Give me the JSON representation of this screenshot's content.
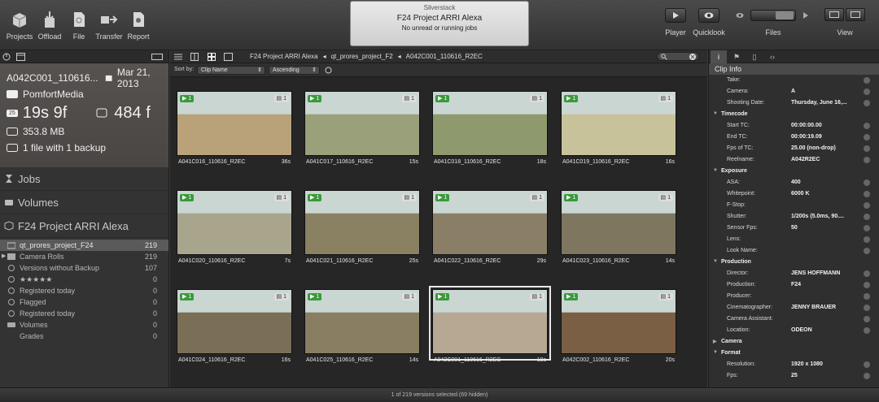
{
  "toolbar": {
    "buttons": [
      {
        "label": "Projects",
        "icon": "projects-icon"
      },
      {
        "label": "Offload",
        "icon": "offload-icon"
      },
      {
        "label": "File",
        "icon": "file-icon"
      },
      {
        "label": "Transfer",
        "icon": "transfer-icon"
      },
      {
        "label": "Report",
        "icon": "report-icon"
      }
    ],
    "status": {
      "app": "Silverstack",
      "project": "F24 Project ARRI Alexa",
      "jobs": "No unread or running jobs"
    },
    "right": [
      {
        "label": "Player"
      },
      {
        "label": "Quicklook"
      },
      {
        "label": "Files"
      },
      {
        "label": "View"
      }
    ]
  },
  "left": {
    "clip_name": "A042C001_110616...",
    "date": "Mar 21, 2013",
    "owner": "PomfortMedia",
    "fps_chip": "25",
    "duration": "19s 9f",
    "frames": "484 f",
    "size": "353.8 MB",
    "backup": "1 file with 1 backup",
    "sections": [
      "Jobs",
      "Volumes",
      "F24 Project ARRI Alexa"
    ],
    "items": [
      {
        "label": "qt_prores_project_F24",
        "count": "219"
      },
      {
        "label": "Camera Rolls",
        "count": "219"
      },
      {
        "label": "Versions without Backup",
        "count": "107"
      },
      {
        "label": "★★★★★",
        "count": "0"
      },
      {
        "label": "Registered today",
        "count": "0"
      },
      {
        "label": "Flagged",
        "count": "0"
      },
      {
        "label": "Registered today",
        "count": "0"
      },
      {
        "label": "Volumes",
        "count": "0"
      },
      {
        "label": "Grades",
        "count": "0"
      }
    ]
  },
  "center": {
    "breadcrumb": [
      "F24 Project ARRI Alexa",
      "qt_prores_project_F2",
      "A042C001_110616_R2EC"
    ],
    "sort_by_label": "Sort by:",
    "sort_field": "Clip Name",
    "sort_order": "Ascending",
    "clips": [
      {
        "name": "A041C016_110616_R2EC",
        "dur": "36s",
        "badge": "1",
        "bg": "#b9a27a"
      },
      {
        "name": "A041C017_110616_R2EC",
        "dur": "15s",
        "badge": "1",
        "bg": "#9aa07a"
      },
      {
        "name": "A041C018_110616_R2EC",
        "dur": "18s",
        "badge": "1",
        "bg": "#8e9a6e"
      },
      {
        "name": "A041C019_110616_R2EC",
        "dur": "16s",
        "badge": "1",
        "bg": "#c8c29a"
      },
      {
        "name": "A041C020_110616_R2EC",
        "dur": "7s",
        "badge": "1",
        "bg": "#a9a48c"
      },
      {
        "name": "A041C021_110616_R2EC",
        "dur": "25s",
        "badge": "1",
        "bg": "#8a8062"
      },
      {
        "name": "A041C022_110616_R2EC",
        "dur": "29s",
        "badge": "1",
        "bg": "#8a7f66"
      },
      {
        "name": "A041C023_110616_R2EC",
        "dur": "14s",
        "badge": "1",
        "bg": "#7f7660"
      },
      {
        "name": "A041C024_110616_R2EC",
        "dur": "16s",
        "badge": "1",
        "bg": "#7a6e56"
      },
      {
        "name": "A041C025_110616_R2EC",
        "dur": "14s",
        "badge": "1",
        "bg": "#8a7e62"
      },
      {
        "name": "A042C001_110616_R2EC",
        "dur": "19s",
        "badge": "1",
        "bg": "#b7a894"
      },
      {
        "name": "A042C002_110616_R2EC",
        "dur": "20s",
        "badge": "1",
        "bg": "#7a5f44"
      }
    ],
    "status": "1 of 219 versions selected (69 hidden)"
  },
  "right": {
    "header": "Clip Info",
    "rows": [
      {
        "type": "kv",
        "k": "Take:",
        "v": ""
      },
      {
        "type": "kv",
        "k": "Camera:",
        "v": "A"
      },
      {
        "type": "kv",
        "k": "Shooting Date:",
        "v": "Thursday, June 16,..."
      },
      {
        "type": "grp",
        "t": "Timecode"
      },
      {
        "type": "kv",
        "k": "Start TC:",
        "v": "00:00:00.00"
      },
      {
        "type": "kv",
        "k": "End TC:",
        "v": "00:00:19.09"
      },
      {
        "type": "kv",
        "k": "Fps of TC:",
        "v": "25.00 (non-drop)"
      },
      {
        "type": "kv",
        "k": "Reelname:",
        "v": "A042R2EC"
      },
      {
        "type": "grp",
        "t": "Exposure"
      },
      {
        "type": "kv",
        "k": "ASA:",
        "v": "400"
      },
      {
        "type": "kv",
        "k": "Whitepoint:",
        "v": "6000 K"
      },
      {
        "type": "kv",
        "k": "F-Stop:",
        "v": ""
      },
      {
        "type": "kv",
        "k": "Shutter:",
        "v": "1/200s (5.0ms, 90...."
      },
      {
        "type": "kv",
        "k": "Sensor Fps:",
        "v": "50"
      },
      {
        "type": "kv",
        "k": "Lens:",
        "v": ""
      },
      {
        "type": "kv",
        "k": "Look Name:",
        "v": ""
      },
      {
        "type": "grp",
        "t": "Production"
      },
      {
        "type": "kv",
        "k": "Director:",
        "v": "JENS HOFFMANN"
      },
      {
        "type": "kv",
        "k": "Production:",
        "v": "F24"
      },
      {
        "type": "kv",
        "k": "Producer:",
        "v": ""
      },
      {
        "type": "kv",
        "k": "Cinematographer:",
        "v": "JENNY BRAUER"
      },
      {
        "type": "kv",
        "k": "Camera Assistant:",
        "v": ""
      },
      {
        "type": "kv",
        "k": "Location:",
        "v": "ODEON"
      },
      {
        "type": "grp",
        "t": "Camera"
      },
      {
        "type": "grp",
        "t": "Format"
      },
      {
        "type": "kv",
        "k": "Resolution:",
        "v": "1920 x 1080"
      },
      {
        "type": "kv",
        "k": "Fps:",
        "v": "25"
      }
    ]
  }
}
